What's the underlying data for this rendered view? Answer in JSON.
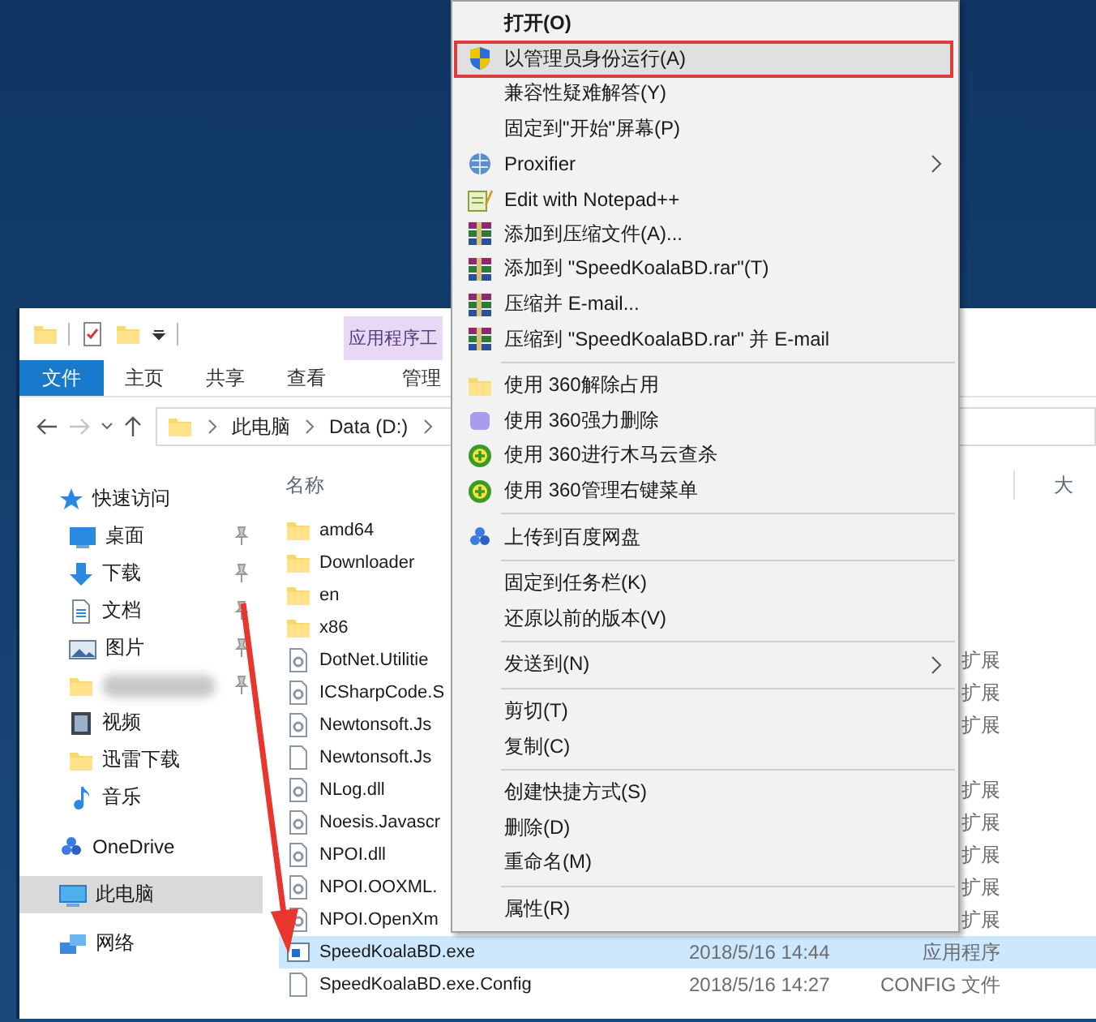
{
  "title_bar": {
    "context_tab": "应用程序工"
  },
  "ribbon_tabs": [
    {
      "label": "文件",
      "kind": "file",
      "selected": false
    },
    {
      "label": "主页",
      "kind": "tab",
      "selected": false
    },
    {
      "label": "共享",
      "kind": "tab",
      "selected": false
    },
    {
      "label": "查看",
      "kind": "tab",
      "selected": false
    },
    {
      "label": "管理",
      "kind": "context",
      "selected": false
    }
  ],
  "address_bar": {
    "path": [
      "此电脑",
      "Data (D:)"
    ]
  },
  "nav_pane": [
    {
      "label": "快速访问",
      "selected": false,
      "children": [
        {
          "label": "桌面",
          "pinned": true,
          "selected": false
        },
        {
          "label": "下载",
          "pinned": true,
          "selected": false
        },
        {
          "label": "文档",
          "pinned": true,
          "selected": false
        },
        {
          "label": "图片",
          "pinned": true,
          "selected": false
        },
        {
          "blurred": true,
          "pinned": true,
          "selected": false
        },
        {
          "label": "视频",
          "pinned": false,
          "selected": false
        },
        {
          "label": "迅雷下载",
          "pinned": false,
          "selected": false
        },
        {
          "label": "音乐",
          "pinned": false,
          "selected": false
        }
      ]
    },
    {
      "label": "OneDrive",
      "selected": false
    },
    {
      "label": "此电脑",
      "selected": true
    },
    {
      "label": "网络",
      "selected": false
    }
  ],
  "file_list": {
    "columns": [
      "名称",
      "大"
    ],
    "rows": [
      {
        "name": "amd64",
        "kind": "folder",
        "selected": false
      },
      {
        "name": "Downloader",
        "kind": "folder",
        "selected": false
      },
      {
        "name": "en",
        "kind": "folder",
        "selected": false
      },
      {
        "name": "x86",
        "kind": "folder",
        "selected": false
      },
      {
        "name": "DotNet.Utilitie",
        "kind": "dll",
        "type": "扩展",
        "selected": false
      },
      {
        "name": "ICSharpCode.S",
        "kind": "dll",
        "type": "扩展",
        "selected": false
      },
      {
        "name": "Newtonsoft.Js",
        "kind": "dll",
        "type": "扩展",
        "selected": false
      },
      {
        "name": "Newtonsoft.Js",
        "kind": "file",
        "selected": false
      },
      {
        "name": "NLog.dll",
        "kind": "dll",
        "type": "扩展",
        "selected": false
      },
      {
        "name": "Noesis.Javascr",
        "kind": "dll",
        "type": "扩展",
        "selected": false
      },
      {
        "name": "NPOI.dll",
        "kind": "dll",
        "type": "扩展",
        "selected": false
      },
      {
        "name": "NPOI.OOXML.",
        "kind": "dll",
        "type": "扩展",
        "selected": false
      },
      {
        "name": "NPOI.OpenXm",
        "kind": "dll",
        "type": "扩展",
        "selected": false
      },
      {
        "name": "SpeedKoalaBD.exe",
        "kind": "exe",
        "date": "2018/5/16 14:44",
        "type": "应用程序",
        "selected": true
      },
      {
        "name": "SpeedKoalaBD.exe.Config",
        "kind": "file",
        "date": "2018/5/16 14:27",
        "type": "CONFIG 文件",
        "selected": false
      }
    ]
  },
  "context_menu": {
    "items": [
      {
        "kind": "default",
        "label": "打开(O)",
        "selected": false
      },
      {
        "kind": "command",
        "label": "以管理员身份运行(A)",
        "selected": true
      },
      {
        "kind": "command",
        "label": "兼容性疑难解答(Y)",
        "selected": false
      },
      {
        "kind": "command",
        "label": "固定到\"开始\"屏幕(P)",
        "selected": false
      },
      {
        "kind": "submenu",
        "label": "Proxifier",
        "selected": false
      },
      {
        "kind": "command",
        "label": "Edit with Notepad++",
        "selected": false
      },
      {
        "kind": "command",
        "label": "添加到压缩文件(A)...",
        "selected": false
      },
      {
        "kind": "command",
        "label": "添加到 \"SpeedKoalaBD.rar\"(T)",
        "selected": false
      },
      {
        "kind": "command",
        "label": "压缩并 E-mail...",
        "selected": false
      },
      {
        "kind": "command",
        "label": "压缩到 \"SpeedKoalaBD.rar\" 并 E-mail",
        "selected": false
      },
      {
        "kind": "separator"
      },
      {
        "kind": "command",
        "label": "使用 360解除占用",
        "selected": false
      },
      {
        "kind": "command",
        "label": "使用 360强力删除",
        "selected": false
      },
      {
        "kind": "command",
        "label": "使用 360进行木马云查杀",
        "selected": false
      },
      {
        "kind": "command",
        "label": "使用 360管理右键菜单",
        "selected": false
      },
      {
        "kind": "separator"
      },
      {
        "kind": "command",
        "label": "上传到百度网盘",
        "selected": false
      },
      {
        "kind": "separator"
      },
      {
        "kind": "command",
        "label": "固定到任务栏(K)",
        "selected": false
      },
      {
        "kind": "command",
        "label": "还原以前的版本(V)",
        "selected": false
      },
      {
        "kind": "separator"
      },
      {
        "kind": "submenu",
        "label": "发送到(N)",
        "selected": false
      },
      {
        "kind": "separator"
      },
      {
        "kind": "command",
        "label": "剪切(T)",
        "selected": false
      },
      {
        "kind": "command",
        "label": "复制(C)",
        "selected": false
      },
      {
        "kind": "separator"
      },
      {
        "kind": "command",
        "label": "创建快捷方式(S)",
        "selected": false
      },
      {
        "kind": "command",
        "label": "删除(D)",
        "selected": false
      },
      {
        "kind": "command",
        "label": "重命名(M)",
        "selected": false
      },
      {
        "kind": "separator"
      },
      {
        "kind": "command",
        "label": "属性(R)",
        "selected": false
      }
    ]
  }
}
